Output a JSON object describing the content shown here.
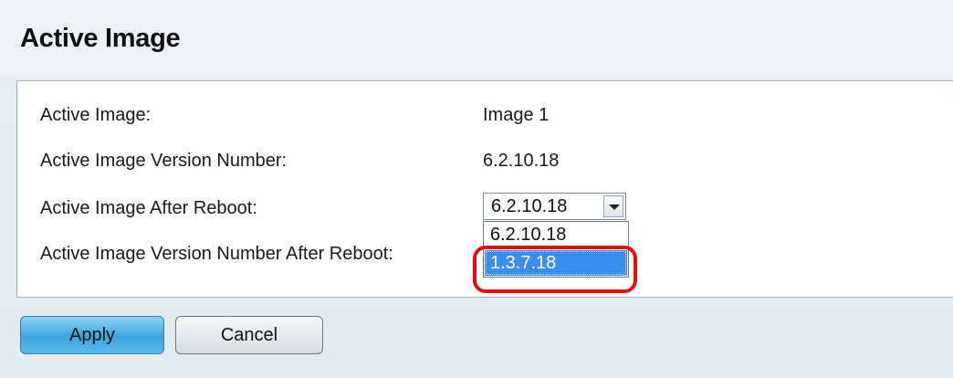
{
  "page": {
    "title": "Active Image"
  },
  "fields": [
    {
      "label": "Active Image:",
      "value": "Image 1"
    },
    {
      "label": "Active Image Version Number:",
      "value": "6.2.10.18"
    },
    {
      "label": "Active Image After Reboot:",
      "value": ""
    },
    {
      "label": "Active Image Version Number After Reboot:",
      "value": ""
    }
  ],
  "reboot_select": {
    "selected": "6.2.10.18",
    "options": [
      "6.2.10.18",
      "1.3.7.18"
    ],
    "highlighted_option": "1.3.7.18"
  },
  "buttons": {
    "apply": "Apply",
    "cancel": "Cancel"
  },
  "colors": {
    "annotation": "#e01010",
    "highlight": "#3b8ef0",
    "apply_button": "#3aa4dd"
  }
}
